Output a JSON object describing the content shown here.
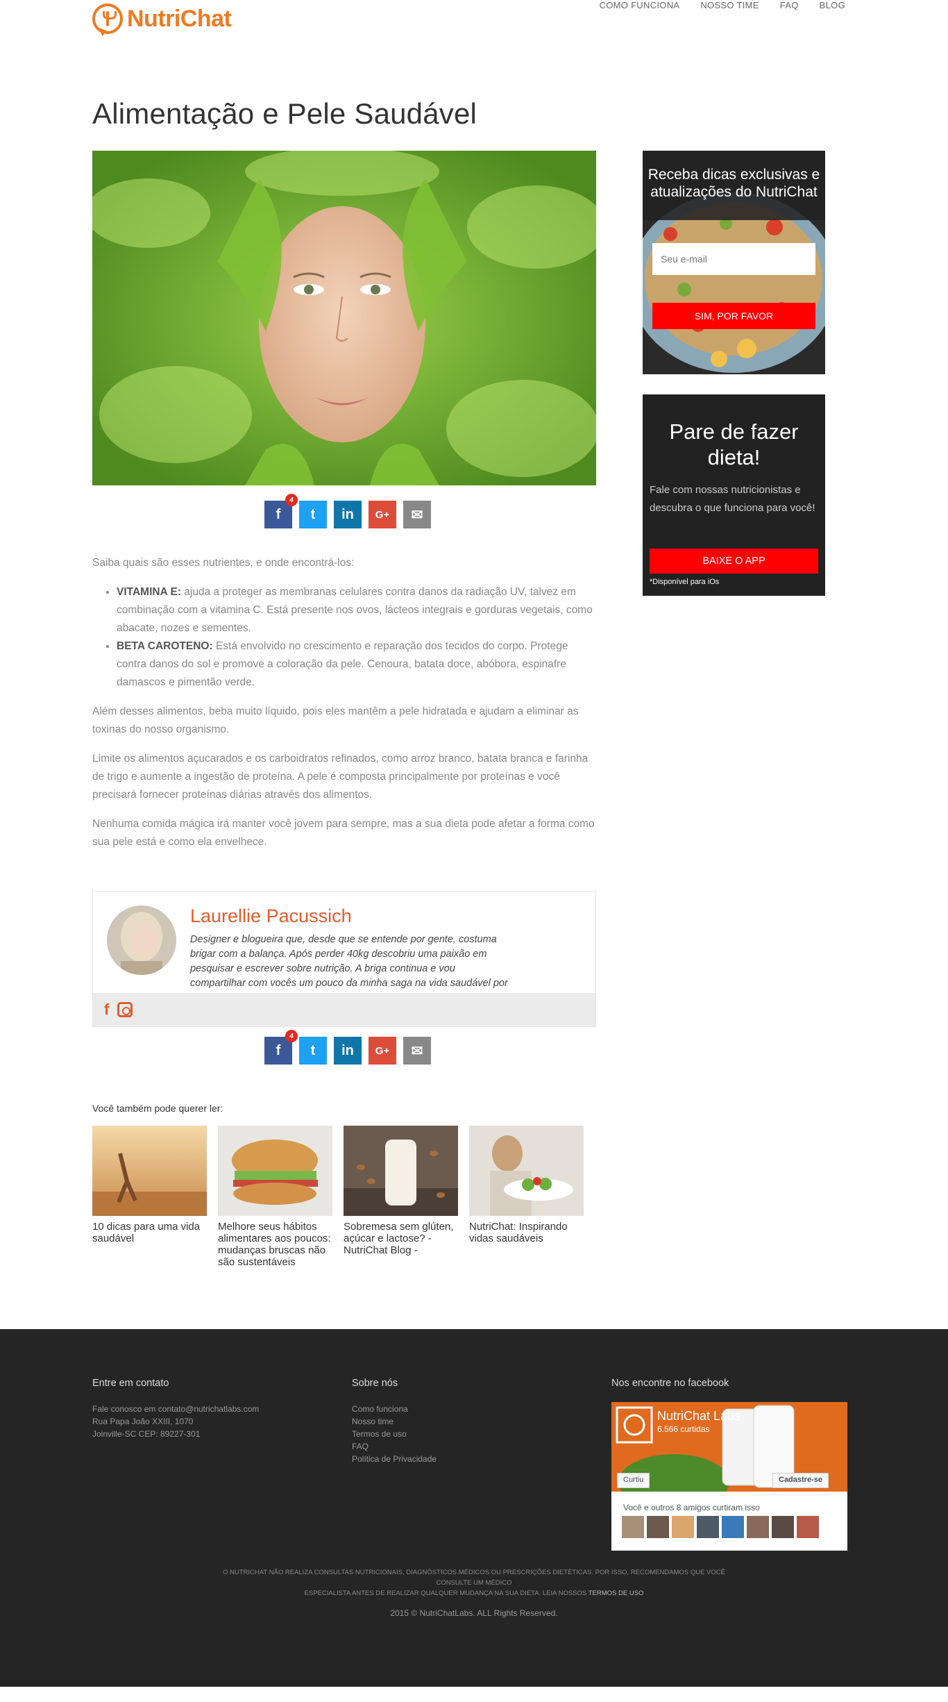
{
  "header": {
    "logo_text": "NutriChat",
    "nav": [
      "COMO FUNCIONA",
      "NOSSO TIME",
      "FAQ",
      "BLOG"
    ]
  },
  "article": {
    "title": "Alimentação e Pele Saudável",
    "intro": "Saiba quais são esses nutrientes, e onde encontrá-los:",
    "bullets": [
      {
        "term": "VITAMINA E:",
        "text": " ajuda a proteger as membranas celulares contra danos da radiação UV, talvez em combinação com a vitamina C. Está presente nos ovos, lácteos integrais e gorduras vegetais, como abacate, nozes e sementes."
      },
      {
        "term": "BETA CAROTENO:",
        "text": " Está envolvido no crescimento e reparação dos tecidos do corpo. Protege contra danos do sol e promove a coloração da pele. Cenoura, batata doce, abóbora, espinafre damascos e pimentão verde."
      }
    ],
    "paragraphs": [
      "Além desses alimentos, beba muito líquido, pois eles mantêm a pele hidratada e ajudam a eliminar as toxinas do nosso organismo.",
      "Limite os alimentos açucarados e os carboidratos refinados, como arroz branco, batata branca e farinha de trigo e aumente a ingestão de proteína. A pele é composta principalmente por proteínas e você precisará fornecer proteínas diárias através dos alimentos.",
      "Nenhuma comida mágica irá manter você jovem para sempre, mas a sua dieta pode afetar a forma como sua pele está e como ela envelhece."
    ]
  },
  "share": {
    "facebook_count": "4"
  },
  "author": {
    "name": "Laurellie Pacussich",
    "bio": "Designer e blogueira que, desde que se entende por gente, costuma brigar com a balança. Após perder 40kg descobriu uma paixão em pesquisar e escrever sobre nutrição. A briga continua e vou compartilhar com vocês um pouco da minha saga na vida saudável por aqui."
  },
  "related": {
    "heading": "Você também pode querer ler:",
    "items": [
      "10 dicas para uma vida saudável",
      "Melhore seus hábitos alimentares aos poucos: mudanças bruscas não são sustentáveis",
      "Sobremesa sem glúten, açúcar e lactose? - NutriChat Blog -",
      "NutriChat: Inspirando vidas saudáveis"
    ]
  },
  "newsletter": {
    "title": "Receba dicas exclusivas e atualizações do NutriChat",
    "email_placeholder": "Seu e-mail",
    "button": "SIM, POR FAVOR"
  },
  "app_promo": {
    "title": "Pare de fazer dieta!",
    "text": "Fale com nossas nutricionistas e descubra o que funciona para você!",
    "button": "BAIXE O APP",
    "note": "*Disponível para iOs"
  },
  "footer": {
    "contact": {
      "heading": "Entre em contato",
      "lines": [
        "Fale conosco em contato@nutrichatlabs.com",
        "Rua Papa João XXIII, 1070",
        "Joinville-SC CEP: 89227-301"
      ]
    },
    "about": {
      "heading": "Sobre nós",
      "links": [
        "Como funciona",
        "Nosso time",
        "Termos de uso",
        "FAQ",
        "Política de Privacidade"
      ]
    },
    "facebook": {
      "heading": "Nos encontre no facebook",
      "page_name": "NutriChat Labs",
      "likes": "6.566 curtidas",
      "liked_button": "Curtiu",
      "signup_button": "Cadastre-se",
      "friends_text": "Você e outros 8 amigos curtiram isso"
    },
    "disclaimer_line1": "O NUTRICHAT NÃO REALIZA CONSULTAS NUTRICIONAIS, DIAGNÓSTICOS MÉDICOS OU PRESCRIÇÕES DIETÉTICAS. POR ISSO, RECOMENDAMOS QUE VOCÊ CONSULTE UM MÉDICO",
    "disclaimer_line2": "ESPECIALISTA ANTES DE REALIZAR QUALQUER MUDANÇA NA SUA DIETA. Leia nossos ",
    "disclaimer_link": "TERMOS DE USO",
    "copyright": "2015 © NutriChatLabs. ALL Rights Reserved."
  },
  "colors": {
    "brand_orange": "#ee7b22",
    "author_accent": "#e35c2d",
    "cta_red": "#ff0000",
    "footer_bg": "#252525"
  }
}
